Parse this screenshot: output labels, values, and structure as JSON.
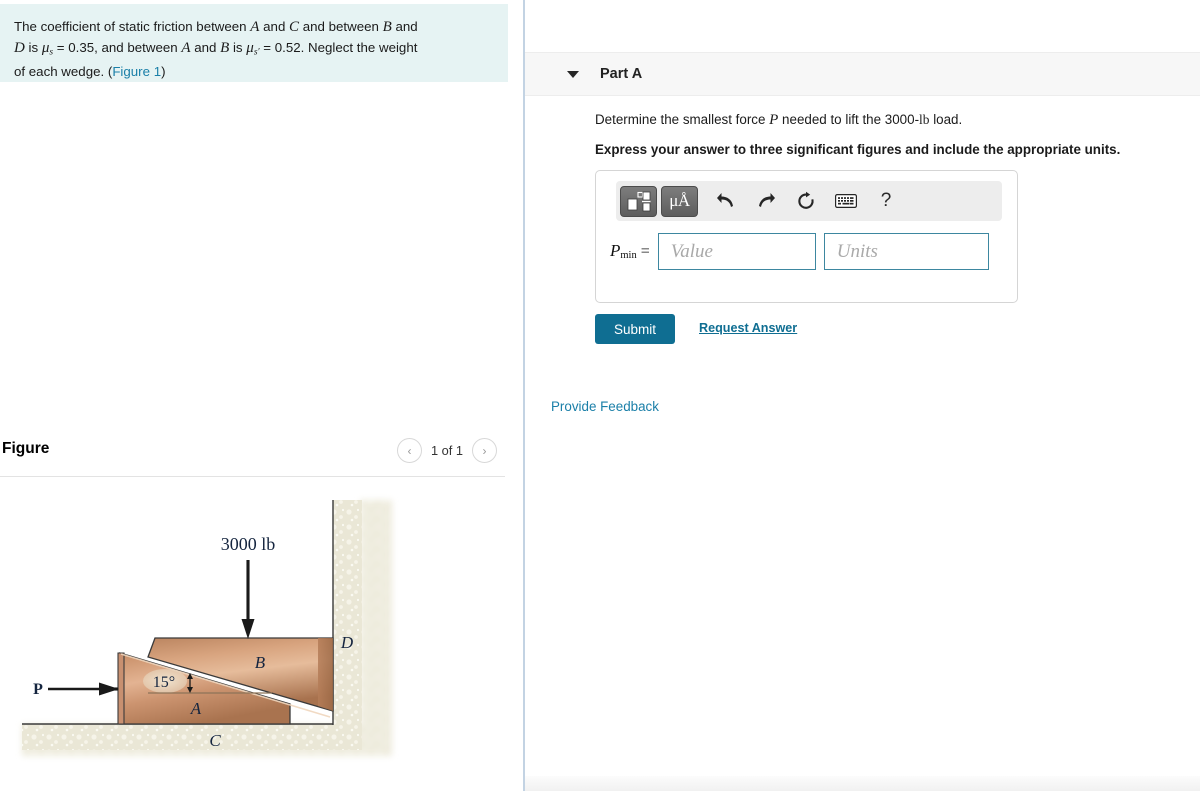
{
  "problem": {
    "line1_a": "The coefficient of static friction between ",
    "var_A": "A",
    "line1_b": " and ",
    "var_C": "C",
    "line1_c": " and between ",
    "var_B": "B",
    "line1_d": " and",
    "line2_a": "D",
    "line2_b": " is ",
    "mu_symbol": "μ",
    "mu_sub1": "s",
    "line2_c": " = 0.35, and between ",
    "var_A2": "A",
    "line2_d": " and ",
    "var_B2": "B",
    "line2_e": " is ",
    "mu_sub2": "s′",
    "line2_f": " = 0.52. Neglect the weight",
    "line3_a": "of each wedge. (",
    "figure_link": "Figure 1",
    "line3_b": ")"
  },
  "figure": {
    "title": "Figure",
    "counter": "1 of 1",
    "prev_icon": "chevron-left-icon",
    "next_icon": "chevron-right-icon",
    "prev_glyph": "‹",
    "next_glyph": "›",
    "labels": {
      "load": "3000 lb",
      "force": "P",
      "angle": "15°",
      "wedge_a": "A",
      "wedge_b": "B",
      "ground_c": "C",
      "wall_d": "D"
    },
    "colors": {
      "wedge_light": "#d8a27e",
      "wedge_mid": "#c08a64",
      "wedge_dark": "#a9734f",
      "ground": "#e8e5d3",
      "outline": "#3a3a3a",
      "label_color": "#1a2a4a"
    }
  },
  "part": {
    "caret_icon": "caret-down-icon",
    "label": "Part A",
    "question_a": "Determine the smallest force ",
    "question_var": "P",
    "question_b": " needed to lift the 3000-",
    "question_unit": "lb",
    "question_c": " load.",
    "instruction": "Express your answer to three significant figures and include the appropriate units."
  },
  "answer": {
    "toolbar": [
      {
        "name": "math-template-button",
        "icon": "math-template-icon",
        "label": ""
      },
      {
        "name": "units-button",
        "icon": "micro-angstrom-icon",
        "label": "μÅ"
      },
      {
        "name": "undo-button",
        "icon": "undo-arrow-icon",
        "label": ""
      },
      {
        "name": "redo-button",
        "icon": "redo-arrow-icon",
        "label": ""
      },
      {
        "name": "reset-button",
        "icon": "reset-circular-arrow-icon",
        "label": ""
      },
      {
        "name": "keyboard-button",
        "icon": "keyboard-icon",
        "label": ""
      },
      {
        "name": "help-button",
        "icon": "question-mark-icon",
        "label": "?"
      }
    ],
    "variable": "P",
    "variable_sub": "min",
    "equals": "=",
    "value_placeholder": "Value",
    "value_current": "",
    "units_placeholder": "Units",
    "units_current": "",
    "submit_label": "Submit",
    "request_answer_label": "Request Answer"
  },
  "feedback": {
    "label": "Provide Feedback"
  },
  "theme": {
    "accent": "#0f6e92",
    "link": "#1a7fa8",
    "problem_bg": "#e6f3f3",
    "header_bg": "#f7f7f7",
    "divider": "#c3d3e3",
    "field_border": "#3d87a0"
  }
}
